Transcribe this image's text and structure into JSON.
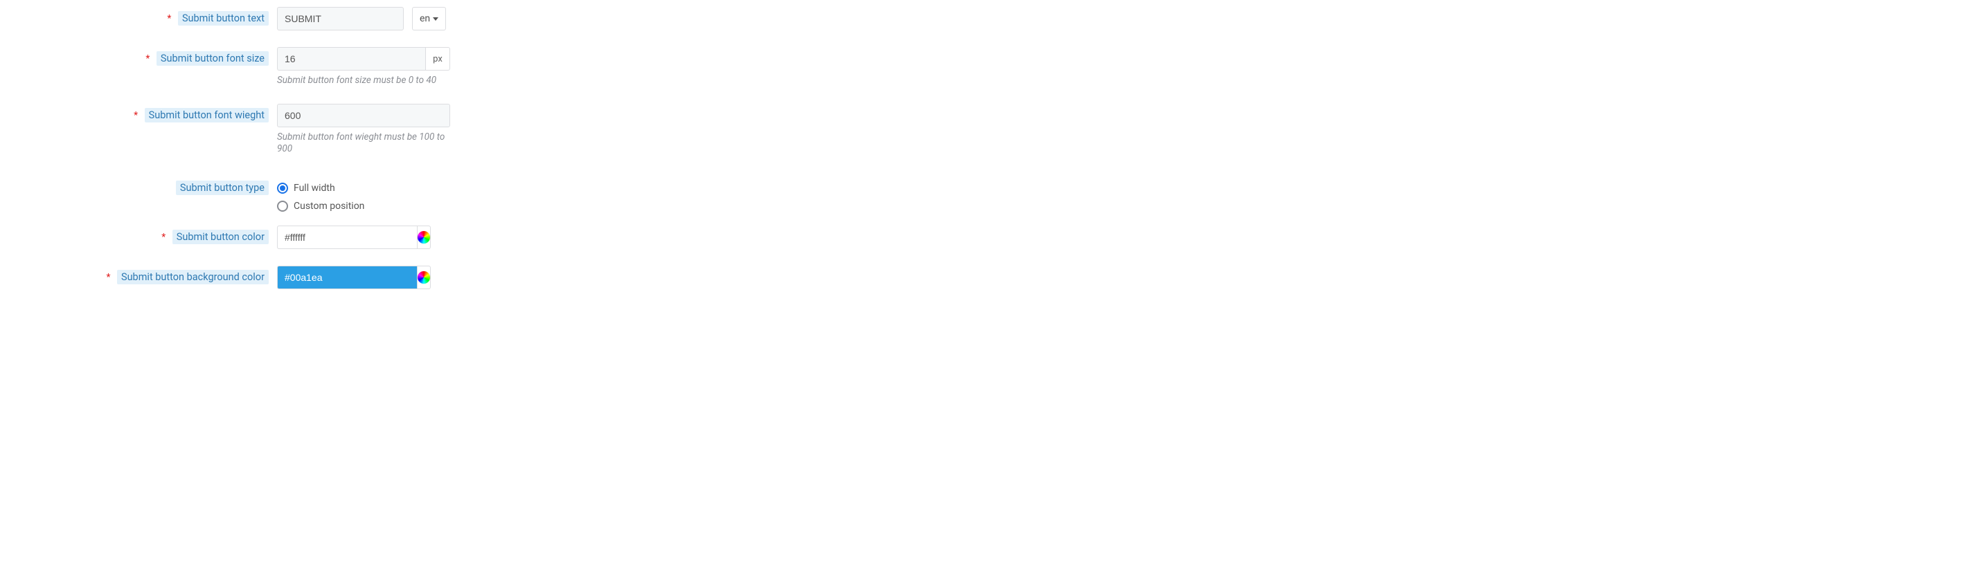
{
  "fields": {
    "submit_text": {
      "label": "Submit button text",
      "required": true,
      "value": "SUBMIT",
      "lang": "en"
    },
    "font_size": {
      "label": "Submit button font size",
      "required": true,
      "value": "16",
      "unit": "px",
      "help": "Submit button font size must be 0 to 40"
    },
    "font_weight": {
      "label": "Submit button font wieght",
      "required": true,
      "value": "600",
      "help": "Submit button font wieght must be 100 to 900"
    },
    "button_type": {
      "label": "Submit button type",
      "required": false,
      "options": {
        "full_width": "Full width",
        "custom_position": "Custom position"
      },
      "selected": "full_width"
    },
    "color": {
      "label": "Submit button color",
      "required": true,
      "value": "#ffffff"
    },
    "bg_color": {
      "label": "Submit button background color",
      "required": true,
      "value": "#00a1ea"
    }
  },
  "ui": {
    "required_mark": "*"
  }
}
